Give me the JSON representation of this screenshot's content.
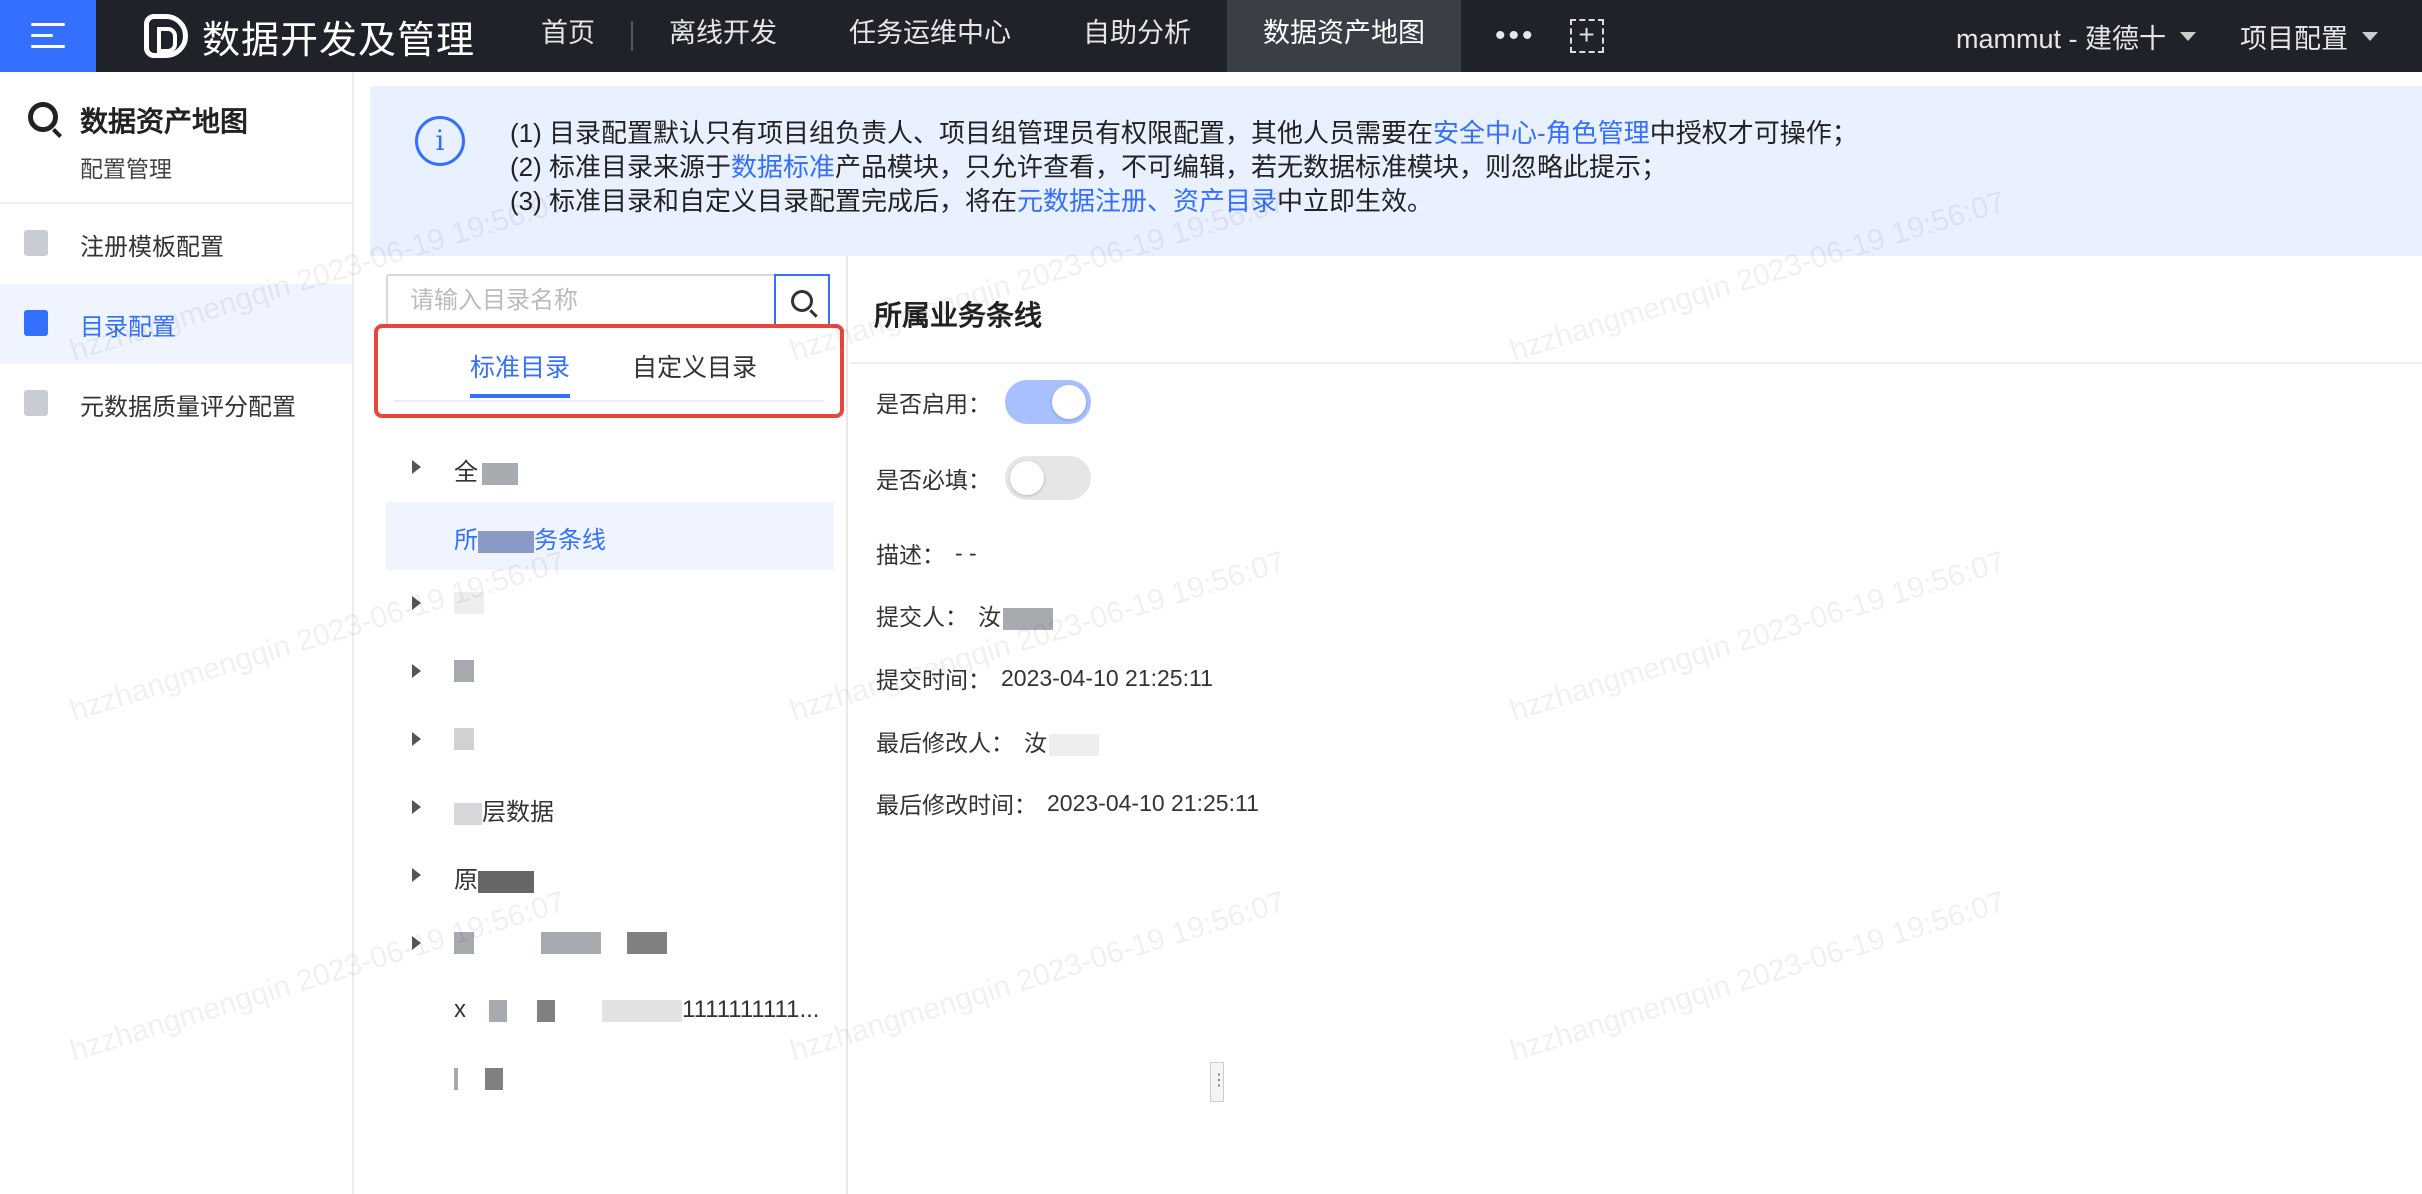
{
  "topbar": {
    "app_title": "数据开发及管理",
    "nav": [
      "首页",
      "离线开发",
      "任务运维中心",
      "自助分析",
      "数据资产地图"
    ],
    "active_nav": "数据资产地图",
    "more": "•••",
    "user": "mammut - 建德十",
    "project_config": "项目配置"
  },
  "sidebar": {
    "title": "数据资产地图",
    "subtitle": "配置管理",
    "items": [
      {
        "label": "注册模板配置",
        "icon": "edit-icon"
      },
      {
        "label": "目录配置",
        "icon": "edit-icon",
        "active": true
      },
      {
        "label": "元数据质量评分配置",
        "icon": "edit-icon"
      }
    ]
  },
  "notice": {
    "line1_prefix": "(1) 目录配置默认只有项目组负责人、项目组管理员有权限配置，其他人员需要在",
    "line1_link": "安全中心-角色管理",
    "line1_suffix": "中授权才可操作；",
    "line2_prefix": "(2) 标准目录来源于",
    "line2_link": "数据标准",
    "line2_suffix": "产品模块，只允许查看，不可编辑，若无数据标准模块，则忽略此提示；",
    "line3_prefix": "(3) 标准目录和自定义目录配置完成后，将在",
    "line3_link1": "元数据注册、",
    "line3_link2": "资产目录",
    "line3_suffix": "中立即生效。"
  },
  "catalog": {
    "search_placeholder": "请输入目录名称",
    "tabs": [
      "标准目录",
      "自定义目录"
    ],
    "tree": {
      "n1": "全",
      "n2": "所",
      "n2b": "务条线",
      "n6": "层数据",
      "n7": "原",
      "n9a": "x",
      "n9b": "1111111111..."
    }
  },
  "detail": {
    "title": "所属业务条线",
    "enabled_label": "是否启用：",
    "required_label": "是否必填：",
    "enabled": true,
    "required": false,
    "desc_label": "描述：",
    "desc_value": "- -",
    "submitter_label": "提交人：",
    "submitter_value": "汝",
    "submit_time_label": "提交时间：",
    "submit_time_value": "2023-04-10 21:25:11",
    "modifier_label": "最后修改人：",
    "modifier_value": "汝",
    "modify_time_label": "最后修改时间：",
    "modify_time_value": "2023-04-10 21:25:11"
  },
  "watermark": "hzzhangmengqin 2023-06-19 19:56:07"
}
